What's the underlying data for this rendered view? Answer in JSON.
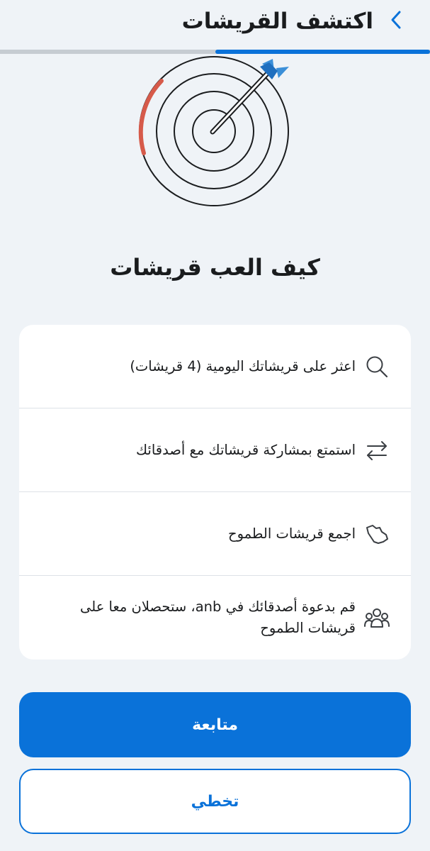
{
  "header": {
    "title": "اكتشف القريشات",
    "back_icon": "chevron-right-icon"
  },
  "progress": {
    "value": 0.5,
    "color": "#0a72d9"
  },
  "illustration": {
    "icon": "target-dart-icon"
  },
  "main": {
    "title": "كيف العب قريشات",
    "steps": [
      {
        "icon": "search-icon",
        "text": "اعثر على قريشاتك اليومية (4 قريشات)"
      },
      {
        "icon": "swap-arrows-icon",
        "text": "استمتع بمشاركة قريشاتك مع أصدقائك"
      },
      {
        "icon": "saudi-map-icon",
        "text": "اجمع قريشات الطموح"
      },
      {
        "icon": "people-group-icon",
        "text": "قم بدعوة أصدقائك في anb، ستحصلان معا على قريشات الطموح"
      }
    ]
  },
  "buttons": {
    "continue_label": "متابعة",
    "skip_label": "تخطي"
  },
  "colors": {
    "accent": "#0a72d9",
    "background": "#eff3f7"
  }
}
